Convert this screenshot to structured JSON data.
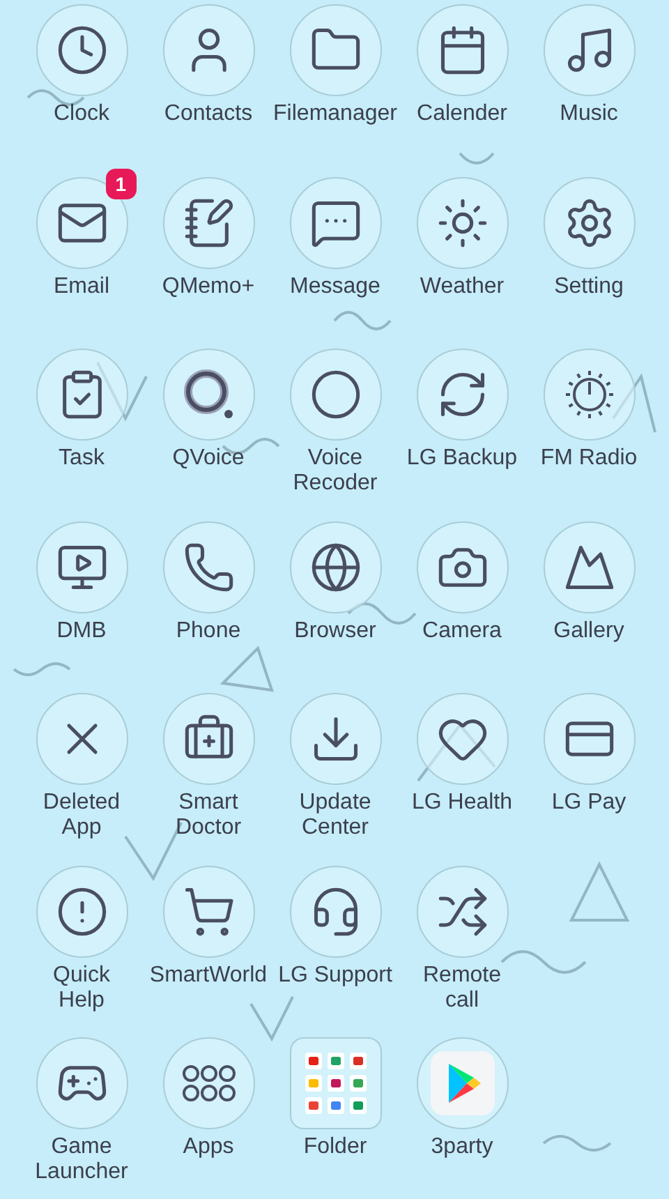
{
  "rows": [
    [
      {
        "label": "Clock",
        "kind": "app"
      },
      {
        "label": "Contacts",
        "kind": "app"
      },
      {
        "label": "Filemanager",
        "kind": "app"
      },
      {
        "label": "Calender",
        "kind": "app"
      },
      {
        "label": "Music",
        "kind": "app"
      }
    ],
    [
      {
        "label": "Email",
        "kind": "app",
        "badge": "1"
      },
      {
        "label": "QMemo+",
        "kind": "app"
      },
      {
        "label": "Message",
        "kind": "app"
      },
      {
        "label": "Weather",
        "kind": "app"
      },
      {
        "label": "Setting",
        "kind": "app"
      }
    ],
    [
      {
        "label": "Task",
        "kind": "app"
      },
      {
        "label": "QVoice",
        "kind": "app"
      },
      {
        "label": "Voice\nRecoder",
        "kind": "app"
      },
      {
        "label": "LG Backup",
        "kind": "app"
      },
      {
        "label": "FM Radio",
        "kind": "app"
      }
    ],
    [
      {
        "label": "DMB",
        "kind": "app"
      },
      {
        "label": "Phone",
        "kind": "app"
      },
      {
        "label": "Browser",
        "kind": "app"
      },
      {
        "label": "Camera",
        "kind": "app"
      },
      {
        "label": "Gallery",
        "kind": "app"
      }
    ],
    [
      {
        "label": "Deleted\nApp",
        "kind": "app"
      },
      {
        "label": "Smart\nDoctor",
        "kind": "app"
      },
      {
        "label": "Update\nCenter",
        "kind": "app"
      },
      {
        "label": "LG Health",
        "kind": "app"
      },
      {
        "label": "LG Pay",
        "kind": "app"
      }
    ],
    [
      {
        "label": "Quick\nHelp",
        "kind": "app"
      },
      {
        "label": "SmartWorld",
        "kind": "app"
      },
      {
        "label": "LG Support",
        "kind": "app"
      },
      {
        "label": "Remote\ncall",
        "kind": "app"
      }
    ],
    [
      {
        "label": "Game\nLauncher",
        "kind": "app"
      },
      {
        "label": "Apps",
        "kind": "app"
      },
      {
        "label": "Folder",
        "kind": "folder"
      },
      {
        "label": "3party",
        "kind": "store"
      }
    ]
  ]
}
